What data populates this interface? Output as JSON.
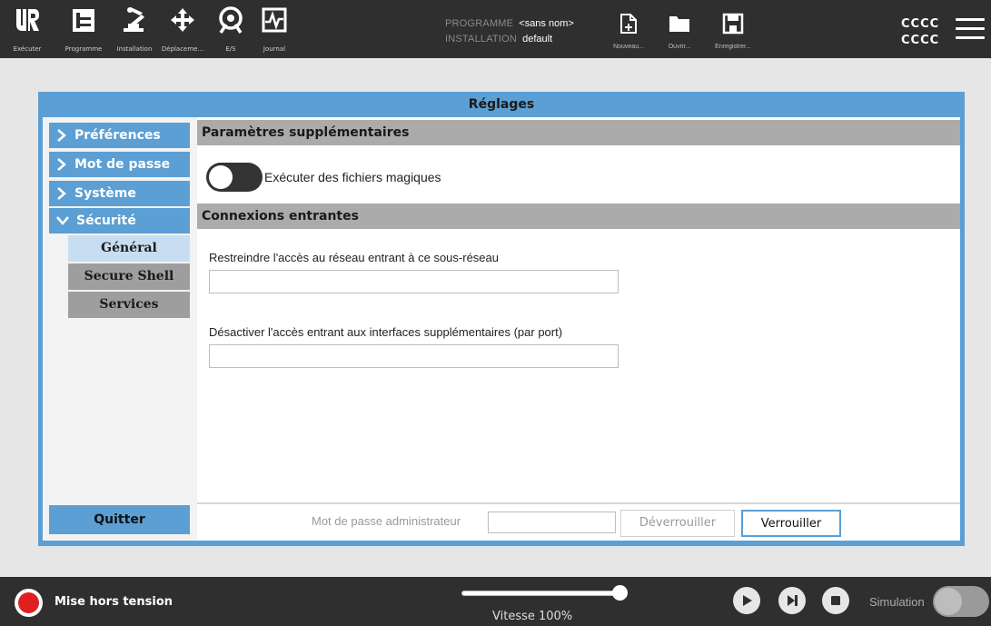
{
  "topbar": {
    "nav": [
      {
        "label": "Exécuter",
        "icon": "ur-logo-icon"
      },
      {
        "label": "Programme",
        "icon": "program-icon"
      },
      {
        "label": "Installation",
        "icon": "robot-arm-icon"
      },
      {
        "label": "Déplaceme...",
        "icon": "move-icon"
      },
      {
        "label": "E/S",
        "icon": "io-icon"
      },
      {
        "label": "Journal",
        "icon": "log-icon"
      }
    ],
    "program_key": "PROGRAMME",
    "program_value": "<sans nom>",
    "installation_key": "INSTALLATION",
    "installation_value": "default",
    "file_buttons": [
      {
        "label": "Nouveau...",
        "icon": "new-file-icon"
      },
      {
        "label": "Ouvrir...",
        "icon": "folder-icon"
      },
      {
        "label": "Enregistrer...",
        "icon": "save-icon"
      }
    ],
    "user_line1": "CCCC",
    "user_line2": "CCCC"
  },
  "panel": {
    "title": "Réglages",
    "sidebar": {
      "items": [
        {
          "label": "Préférences",
          "expanded": false
        },
        {
          "label": "Mot de passe",
          "expanded": false
        },
        {
          "label": "Système",
          "expanded": false
        },
        {
          "label": "Sécurité",
          "expanded": true
        }
      ],
      "subitems": [
        {
          "label": "Général",
          "active": true
        },
        {
          "label": "Secure Shell",
          "active": false
        },
        {
          "label": "Services",
          "active": false
        }
      ],
      "quit_label": "Quitter"
    },
    "content": {
      "section1_title": "Paramètres supplémentaires",
      "magic_files_label": "Exécuter des fichiers magiques",
      "magic_files_enabled": false,
      "section2_title": "Connexions entrantes",
      "subnet_label": "Restreindre l'accès au réseau entrant à ce sous-réseau",
      "subnet_value": "",
      "ports_label": "Désactiver l'accès entrant aux interfaces supplémentaires (par port)",
      "ports_value": "",
      "admin_password_label": "Mot de passe administrateur",
      "admin_password_value": "",
      "unlock_label": "Déverrouiller",
      "lock_label": "Verrouiller"
    }
  },
  "bottombar": {
    "power_label": "Mise hors tension",
    "speed_label": "Vitesse 100%",
    "speed_fraction": 1.0,
    "simulation_label": "Simulation",
    "simulation_enabled": false
  },
  "colors": {
    "accent_blue": "#5b9fd4",
    "dark_bar": "#2f2f2f",
    "power_red": "#e02020"
  }
}
